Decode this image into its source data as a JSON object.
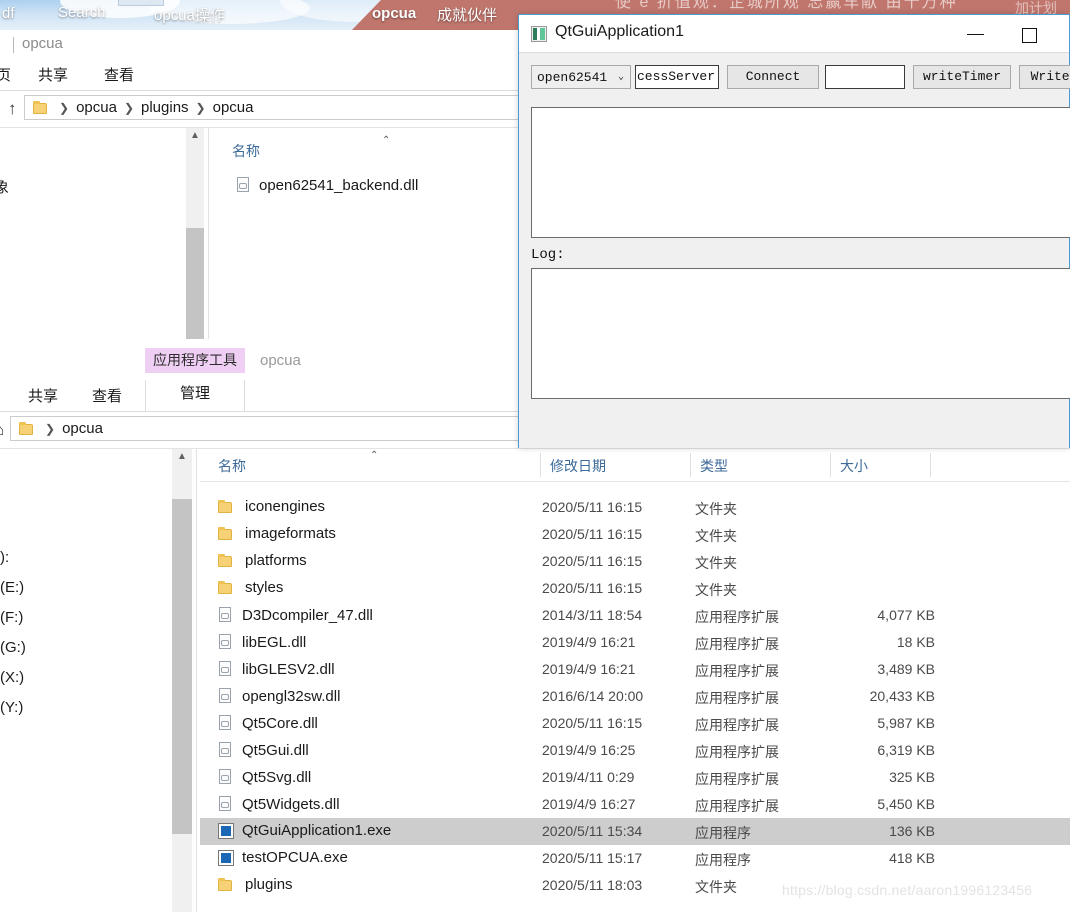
{
  "banner": {
    "tabs": [
      "df",
      "Search",
      "opcua操作"
    ],
    "brand": "opcua",
    "slogan": "成就伙伴",
    "faint_line": "使 e 折值观：企城所观  忘赢车献  由十万种",
    "faint_right": "加计划"
  },
  "explorer_top": {
    "tab_title": "opcua",
    "ribbon": [
      "页",
      "共享",
      "查看"
    ],
    "up_arrow": "↑",
    "breadcrumb": [
      "opcua",
      "plugins",
      "opcua"
    ],
    "nav_fragment": "象",
    "column_header": "名称",
    "sort_caret": "⌃",
    "files": [
      {
        "name": "open62541_backend.dll",
        "icon": "dll-file-icon"
      }
    ]
  },
  "explorer_bottom": {
    "context_tab": "应用程序工具",
    "context_title": "opcua",
    "ribbon": [
      "共享",
      "查看"
    ],
    "selected_tab": "管理",
    "breadcrumb": [
      "opcua"
    ],
    "columns": [
      "名称",
      "修改日期",
      "类型",
      "大小"
    ],
    "sort_caret": "⌃",
    "nav_items": [
      "):",
      "(E:)",
      "(F:)",
      "(G:)",
      "(X:)",
      "(Y:)"
    ],
    "rows": [
      {
        "name": "iconengines",
        "icon": "folder-icon",
        "date": "2020/5/11 16:15",
        "type": "文件夹",
        "size": "",
        "selected": false
      },
      {
        "name": "imageformats",
        "icon": "folder-icon",
        "date": "2020/5/11 16:15",
        "type": "文件夹",
        "size": "",
        "selected": false
      },
      {
        "name": "platforms",
        "icon": "folder-icon",
        "date": "2020/5/11 16:15",
        "type": "文件夹",
        "size": "",
        "selected": false
      },
      {
        "name": "styles",
        "icon": "folder-icon",
        "date": "2020/5/11 16:15",
        "type": "文件夹",
        "size": "",
        "selected": false
      },
      {
        "name": "D3Dcompiler_47.dll",
        "icon": "dll-file-icon",
        "date": "2014/3/11 18:54",
        "type": "应用程序扩展",
        "size": "4,077 KB",
        "selected": false
      },
      {
        "name": "libEGL.dll",
        "icon": "dll-file-icon",
        "date": "2019/4/9 16:21",
        "type": "应用程序扩展",
        "size": "18 KB",
        "selected": false
      },
      {
        "name": "libGLESV2.dll",
        "icon": "dll-file-icon",
        "date": "2019/4/9 16:21",
        "type": "应用程序扩展",
        "size": "3,489 KB",
        "selected": false
      },
      {
        "name": "opengl32sw.dll",
        "icon": "dll-file-icon",
        "date": "2016/6/14 20:00",
        "type": "应用程序扩展",
        "size": "20,433 KB",
        "selected": false
      },
      {
        "name": "Qt5Core.dll",
        "icon": "dll-file-icon",
        "date": "2020/5/11 16:15",
        "type": "应用程序扩展",
        "size": "5,987 KB",
        "selected": false
      },
      {
        "name": "Qt5Gui.dll",
        "icon": "dll-file-icon",
        "date": "2019/4/9 16:25",
        "type": "应用程序扩展",
        "size": "6,319 KB",
        "selected": false
      },
      {
        "name": "Qt5Svg.dll",
        "icon": "dll-file-icon",
        "date": "2019/4/11 0:29",
        "type": "应用程序扩展",
        "size": "325 KB",
        "selected": false
      },
      {
        "name": "Qt5Widgets.dll",
        "icon": "dll-file-icon",
        "date": "2019/4/9 16:27",
        "type": "应用程序扩展",
        "size": "5,450 KB",
        "selected": false
      },
      {
        "name": "QtGuiApplication1.exe",
        "icon": "exe-file-icon",
        "date": "2020/5/11 15:34",
        "type": "应用程序",
        "size": "136 KB",
        "selected": true
      },
      {
        "name": "testOPCUA.exe",
        "icon": "exe-file-icon",
        "date": "2020/5/11 15:17",
        "type": "应用程序",
        "size": "418 KB",
        "selected": false
      },
      {
        "name": "plugins",
        "icon": "folder-icon",
        "date": "2020/5/11 18:03",
        "type": "文件夹",
        "size": "",
        "selected": false
      }
    ]
  },
  "qt_window": {
    "title": "QtGuiApplication1",
    "minimize_label": "—",
    "maximize_label": "□",
    "toolbar": {
      "backend_combo_value": "open62541",
      "backend_combo_chevron": "⌄",
      "endpoint_value": "cessServer",
      "connect_label": "Connect",
      "node_input_value": "",
      "write_timer_label": "writeTimer",
      "write_label": "WriteD"
    },
    "output_text": "",
    "log_label": "Log:",
    "log_text": ""
  },
  "watermark": "https://blog.csdn.net/aaron1996123456",
  "colors": {
    "banner_red": "#c0766d",
    "qt_border": "#4a9ad4",
    "selection": "#cdcdcd",
    "context_tab": "#efcff4",
    "column_header_text": "#3c6a99"
  }
}
